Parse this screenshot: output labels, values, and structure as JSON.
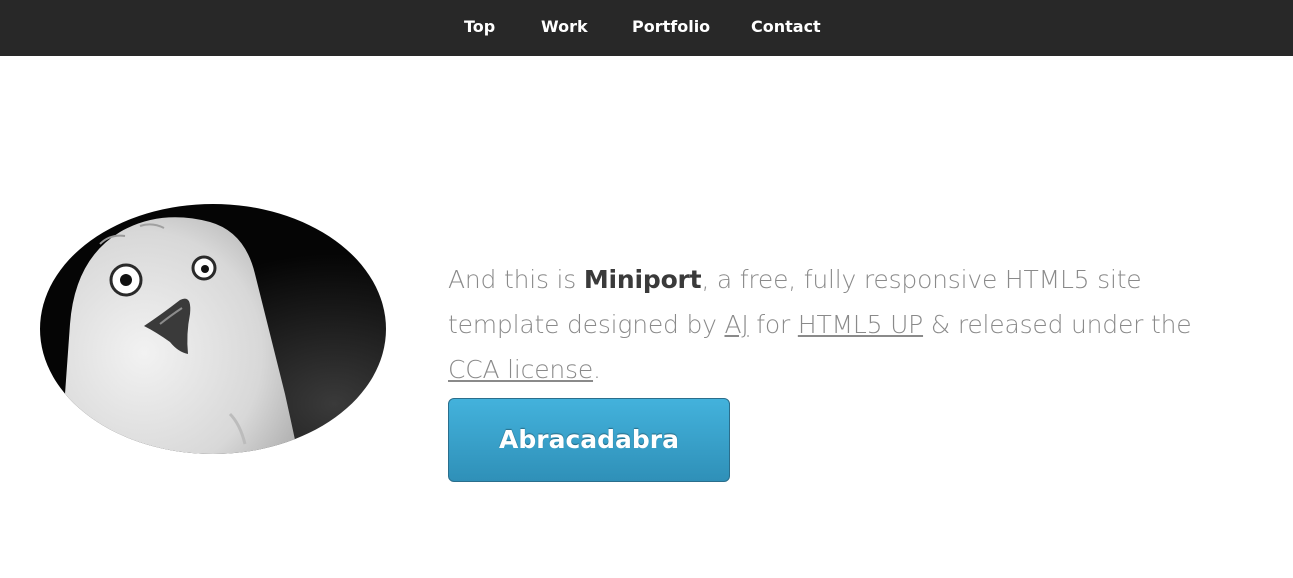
{
  "nav": {
    "items": [
      {
        "label": "Top"
      },
      {
        "label": "Work"
      },
      {
        "label": "Portfolio"
      },
      {
        "label": "Contact"
      }
    ]
  },
  "banner": {
    "image_icon": "owl-photo",
    "text_prefix": "And this is ",
    "site_name": "Miniport",
    "text_middle": ", a free, fully responsive HTML5 site template designed by ",
    "author_link": "AJ",
    "text_for": " for ",
    "html5up_link": "HTML5 UP",
    "text_released": " & released under the ",
    "license_link": "CCA license",
    "text_end": ".",
    "button_label": "Abracadabra"
  },
  "colors": {
    "nav_bg": "#282828",
    "button_blue": "#3a9fc9",
    "body_text": "#8a8a8a"
  }
}
